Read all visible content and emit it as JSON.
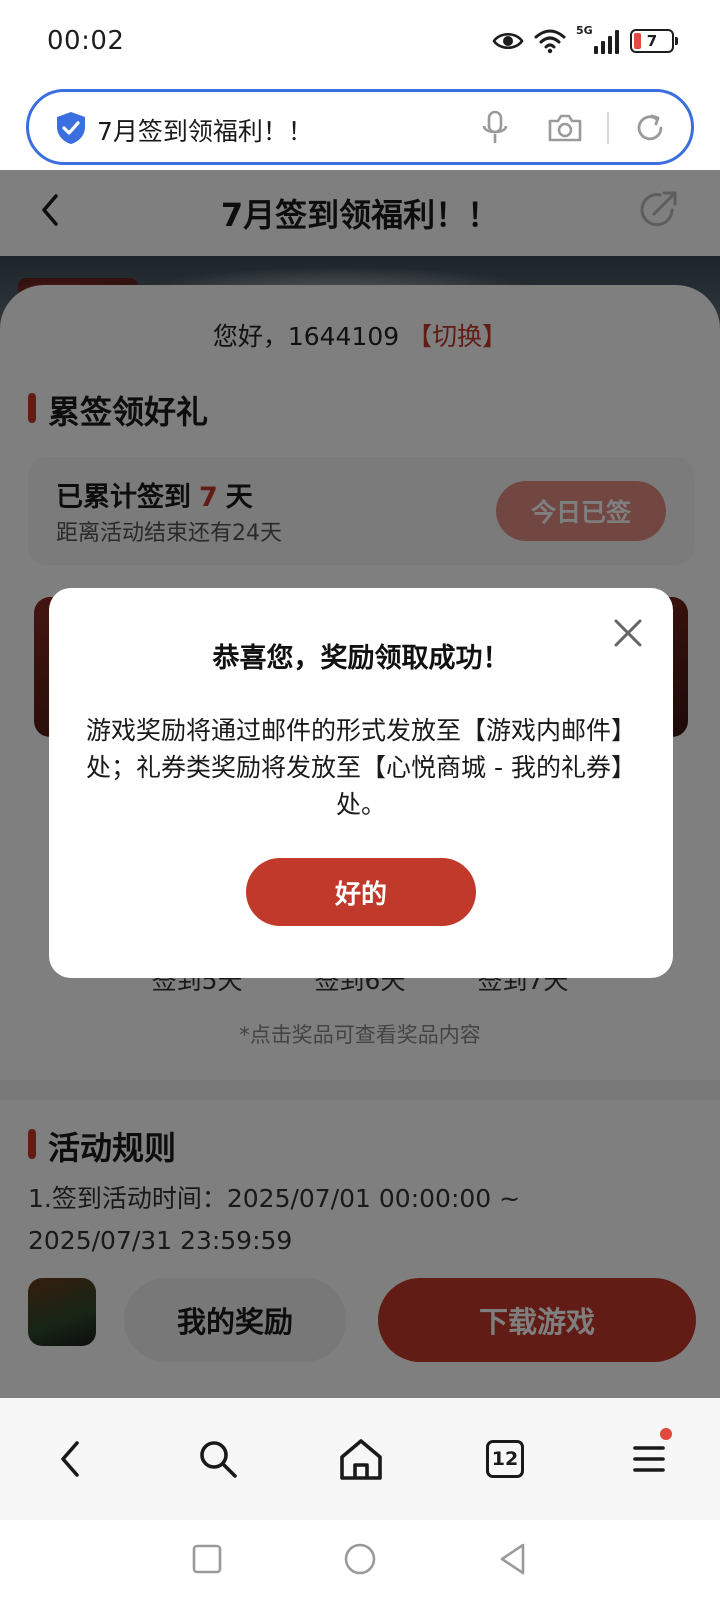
{
  "status_bar": {
    "time": "00:02",
    "network": "5G",
    "battery_level": "7",
    "icons": [
      "eye-icon",
      "wifi-icon",
      "signal-icon",
      "battery-icon"
    ]
  },
  "address_bar": {
    "text": "7月签到领福利！！",
    "icons": [
      "shield-check-icon",
      "microphone-icon",
      "camera-icon",
      "refresh-icon"
    ]
  },
  "page_header": {
    "title": "7月签到领福利！！",
    "icons": [
      "back-arrow-icon",
      "share-icon"
    ]
  },
  "greeting": {
    "text": "您好，1644109",
    "switch_label": "【切换】"
  },
  "cumulative": {
    "section_title": "累签领好礼",
    "signed_prefix": "已累计签到",
    "signed_days": "7",
    "signed_suffix": "天",
    "remaining_text": "距离活动结束还有24天",
    "button_label": "今日已签"
  },
  "prize_days": [
    "签到5天",
    "签到6天",
    "签到7天"
  ],
  "prize_hint": "*点击奖品可查看奖品内容",
  "rules": {
    "section_title": "活动规则",
    "line1": "1.签到活动时间：2025/07/01 00:00:00 ~",
    "line2": "2025/07/31 23:59:59"
  },
  "action_bar": {
    "my_reward_label": "我的奖励",
    "download_label": "下载游戏"
  },
  "modal": {
    "title": "恭喜您，奖励领取成功！",
    "body": "游戏奖励将通过邮件的形式发放至【游戏内邮件】处；礼券类奖励将发放至【心悦商城 - 我的礼券】处。",
    "ok_label": "好的"
  },
  "toolbar": {
    "tab_count": "12",
    "icons": [
      "back-icon",
      "search-icon",
      "home-icon",
      "tabs-icon",
      "menu-icon"
    ]
  },
  "colors": {
    "accent": "#c0392b",
    "address_border": "#3b6fe0",
    "signed_button": "#e48e85"
  }
}
